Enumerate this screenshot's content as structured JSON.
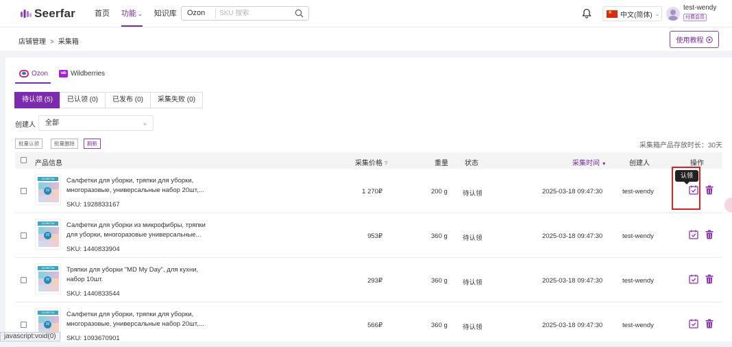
{
  "header": {
    "logo": "Seerfar",
    "nav": [
      {
        "label": "首页"
      },
      {
        "label": "功能"
      },
      {
        "label": "知识库"
      }
    ],
    "search": {
      "select": "Ozon",
      "placeholder": "SKU 搜索"
    },
    "language": "中文(简体)",
    "user": {
      "name": "test-wendy",
      "badge": "付费会员"
    }
  },
  "breadcrumb": {
    "parent": "店铺管理",
    "separator": ">",
    "current": "采集箱"
  },
  "tutorial_label": "使用教程",
  "platform_tabs": [
    {
      "label": "Ozon",
      "icon": "ozon-icon",
      "active": true
    },
    {
      "label": "Wildberries",
      "icon": "wb-icon",
      "active": false
    }
  ],
  "wb_icon_text": "wb",
  "status_tabs": [
    {
      "label": "待认领 (5)",
      "active": true
    },
    {
      "label": "已认领 (0)",
      "active": false
    },
    {
      "label": "已发布 (0)",
      "active": false
    },
    {
      "label": "采集失败 (0)",
      "active": false
    }
  ],
  "filter": {
    "creator_label": "创建人",
    "creator_value": "全部"
  },
  "bulk": {
    "claim": "批量认领",
    "delete": "批量删除",
    "refresh": "刷新"
  },
  "storage_note": "采集箱产品存放时长：30天",
  "table": {
    "headers": {
      "product": "产品信息",
      "price": "采集价格",
      "weight": "重量",
      "status": "状态",
      "time": "采集时间",
      "creator": "创建人",
      "ops": "操作"
    },
    "rows": [
      {
        "title": "Салфетки для уборки, тряпки для уборки, многоразовые, универсальные набор 20шт,...",
        "sku": "SKU: 1928833167",
        "price": "1 270₽",
        "weight": "200 g",
        "status": "待认领",
        "time": "2025-03-18 09:47:30",
        "creator": "test-wendy"
      },
      {
        "title": "Салфетки для уборки из микрофибры, тряпки для уборки, многоразовые универсальные...",
        "sku": "SKU: 1440833904",
        "price": "953₽",
        "weight": "360 g",
        "status": "待认领",
        "time": "2025-03-18 09:47:30",
        "creator": "test-wendy"
      },
      {
        "title": "Тряпки для уборки \"MD My Day\", для кухни, набор 10шт.",
        "sku": "SKU: 1440833544",
        "price": "293₽",
        "weight": "360 g",
        "status": "待认领",
        "time": "2025-03-18 09:47:30",
        "creator": "test-wendy"
      },
      {
        "title": "Салфетки для уборки, тряпки для уборки, многоразовые, универсальные набор 20шт,...",
        "sku": "SKU: 1093670901",
        "price": "566₽",
        "weight": "360 g",
        "status": "待认领",
        "time": "2025-03-18 09:47:30",
        "creator": "test-wendy"
      }
    ]
  },
  "thumb_label": "САЛФЕТКИ",
  "thumb_count": "20",
  "tooltip": "认领",
  "statusbar": "javascript:void(0)",
  "colors": {
    "accent": "#7a2bb0",
    "highlight": "#e02020"
  }
}
